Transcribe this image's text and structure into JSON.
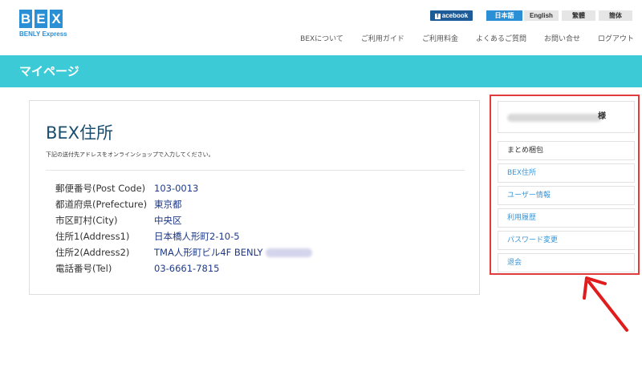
{
  "header": {
    "logo_letters": [
      "B",
      "E",
      "X"
    ],
    "logo_subtitle": "BENLY Express",
    "facebook_label": "acebook",
    "languages": [
      {
        "label": "日本語",
        "active": true
      },
      {
        "label": "English",
        "active": false
      },
      {
        "label": "繁體",
        "active": false
      },
      {
        "label": "簡体",
        "active": false
      }
    ],
    "nav": [
      "BEXについて",
      "ご利用ガイド",
      "ご利用料金",
      "よくあるご質問",
      "お問い合せ",
      "ログアウト"
    ]
  },
  "banner": {
    "title": "マイページ"
  },
  "main": {
    "title": "BEX住所",
    "note": "下記の送付先アドレスをオンラインショップで入力してください。",
    "address": [
      {
        "label": "郵便番号(Post Code)",
        "value": "103-0013"
      },
      {
        "label": "都道府県(Prefecture)",
        "value": "東京都"
      },
      {
        "label": "市区町村(City)",
        "value": "中央区"
      },
      {
        "label": "住所1(Address1)",
        "value": "日本橋人形町2-10-5"
      },
      {
        "label": "住所2(Address2)",
        "value": "TMA人形町ビル4F BENLY"
      },
      {
        "label": "電話番号(Tel)",
        "value": "03-6661-7815"
      }
    ]
  },
  "sidebar": {
    "honorific": "様",
    "items": [
      "まとめ梱包",
      "BEX住所",
      "ユーザー情報",
      "利用履歴",
      "パスワード変更",
      "退会"
    ]
  },
  "colors": {
    "brand_blue": "#2a8fd4",
    "banner_teal": "#3ccad6",
    "highlight_red": "#e23b3b",
    "value_navy": "#1f3a8a"
  }
}
